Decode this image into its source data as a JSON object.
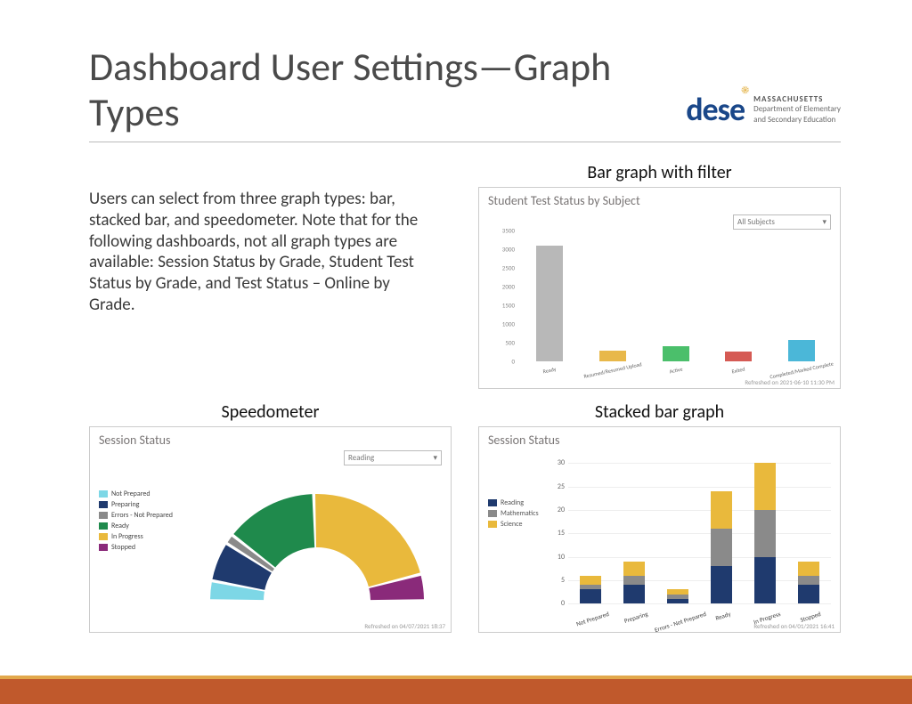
{
  "header": {
    "title": "Dashboard User Settings—Graph Types",
    "logo_mark": "dese",
    "logo_line1": "MASSACHUSETTS",
    "logo_line2": "Department of Elementary",
    "logo_line3": "and Secondary Education"
  },
  "body_text": "Users can select from three graph types: bar, stacked bar, and speedometer. Note that for the following dashboards, not all graph types are available: Session Status by Grade, Student Test Status by Grade, and Test Status – Online by Grade.",
  "captions": {
    "bar": "Bar graph with filter",
    "speed": "Speedometer",
    "stack": "Stacked bar graph"
  },
  "bar_panel": {
    "title": "Student Test Status by Subject",
    "dropdown": "All Subjects",
    "refreshed": "Refreshed on 2021-06-10 11:30 PM"
  },
  "speed_panel": {
    "title": "Session Status",
    "dropdown": "Reading",
    "refreshed": "Refreshed on 04/07/2021 18:37"
  },
  "stack_panel": {
    "title": "Session Status",
    "refreshed": "Refreshed on 04/01/2021 16:41"
  },
  "chart_data": {
    "bar": {
      "type": "bar",
      "title": "Student Test Status by Subject",
      "ylim": [
        0,
        3500
      ],
      "yticks": [
        0,
        500,
        1000,
        1500,
        2000,
        2500,
        3000,
        3500
      ],
      "categories": [
        "Ready",
        "Resumed/Resumed Upload",
        "Active",
        "Exited",
        "Completed/Marked Complete"
      ],
      "values": [
        3100,
        280,
        400,
        260,
        580
      ],
      "colors": [
        "#b8b8b8",
        "#e8b84a",
        "#4bbf6b",
        "#d55a54",
        "#4bb7d8"
      ]
    },
    "speedometer": {
      "type": "pie",
      "title": "Session Status",
      "legend": [
        {
          "label": "Not Prepared",
          "color": "#7dd7e6"
        },
        {
          "label": "Preparing",
          "color": "#1f3a6e"
        },
        {
          "label": "Errors - Not Prepared",
          "color": "#8a8a8a"
        },
        {
          "label": "Ready",
          "color": "#1f8a4c"
        },
        {
          "label": "In Progress",
          "color": "#e9b93c"
        },
        {
          "label": "Stopped",
          "color": "#8a2a7a"
        }
      ],
      "values": [
        6,
        12,
        3,
        28,
        43,
        8
      ]
    },
    "stacked": {
      "type": "bar",
      "title": "Session Status",
      "ylim": [
        0,
        30
      ],
      "yticks": [
        0,
        5,
        10,
        15,
        20,
        25,
        30
      ],
      "categories": [
        "Not Prepared",
        "Preparing",
        "Errors - Not Prepared",
        "Ready",
        "In Progress",
        "Stopped"
      ],
      "series": [
        {
          "name": "Reading",
          "color": "#1f3a6e",
          "values": [
            3,
            4,
            1,
            8,
            10,
            4
          ]
        },
        {
          "name": "Mathematics",
          "color": "#8a8a8a",
          "values": [
            1,
            2,
            1,
            8,
            10,
            2
          ]
        },
        {
          "name": "Science",
          "color": "#e9b93c",
          "values": [
            2,
            3,
            1,
            8,
            10,
            3
          ]
        }
      ]
    }
  }
}
